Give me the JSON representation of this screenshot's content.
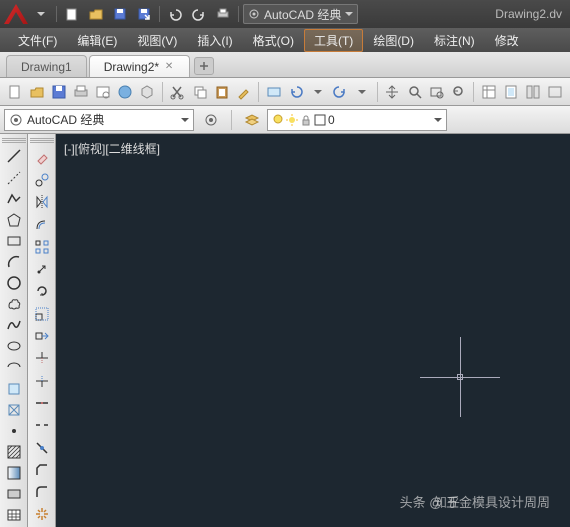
{
  "titlebar": {
    "workspace_label": "AutoCAD 经典",
    "document_title": "Drawing2.dv"
  },
  "menu": {
    "items": [
      "文件(F)",
      "编辑(E)",
      "视图(V)",
      "插入(I)",
      "格式(O)",
      "工具(T)",
      "绘图(D)",
      "标注(N)",
      "修改"
    ]
  },
  "tabs": {
    "items": [
      {
        "label": "Drawing1",
        "active": false
      },
      {
        "label": "Drawing2*",
        "active": true
      }
    ]
  },
  "workspace_combo": {
    "selected": "AutoCAD 经典"
  },
  "layer_combo": {
    "selected": "0"
  },
  "viewport": {
    "label": "[-][俯视][二维线框]"
  },
  "watermark": {
    "left": "知乎",
    "right": "头条 @ 五金模具设计周周"
  }
}
